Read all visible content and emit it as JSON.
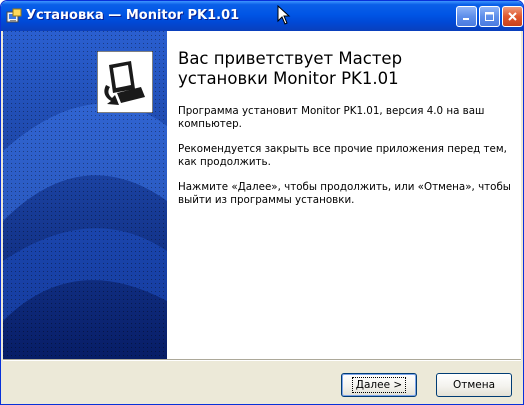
{
  "window": {
    "title": "Установка — Monitor PK1.01"
  },
  "icons": {
    "app": "installer-app-icon",
    "minimize": "minimize-icon",
    "maximize": "maximize-icon",
    "close": "close-icon",
    "cursor": "mouse-cursor-icon",
    "wizard": "computer-setup-icon"
  },
  "main": {
    "title_line1": "Вас приветствует Мастер",
    "title_line2": "установки Monitor PK1.01",
    "paragraph1": "Программа установит Monitor PK1.01, версия 4.0 на ваш компьютер.",
    "paragraph2": "Рекомендуется закрыть все прочие приложения перед тем, как продолжить.",
    "paragraph3": "Нажмите «Далее», чтобы продолжить, или «Отмена», чтобы выйти из программы установки."
  },
  "buttons": {
    "next_mnemonic": "Д",
    "next_rest": "алее >",
    "cancel": "Отмена"
  },
  "colors": {
    "titlebar": "#0055e5",
    "side_panel": "#0a2a85",
    "accent": "#3a78e8"
  }
}
